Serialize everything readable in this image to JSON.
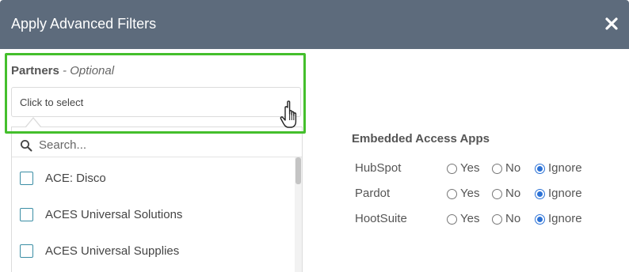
{
  "dialog": {
    "title": "Apply Advanced Filters",
    "close_icon": "close-icon"
  },
  "partners": {
    "label": "Partners",
    "optional_text": "- Optional",
    "select_placeholder": "Click to select",
    "search_placeholder": "Search...",
    "search_value": "",
    "items": [
      {
        "label": "ACE: Disco",
        "checked": false
      },
      {
        "label": "ACES Universal Solutions",
        "checked": false
      },
      {
        "label": "ACES Universal Supplies",
        "checked": false
      }
    ]
  },
  "embedded_apps": {
    "title": "Embedded Access Apps",
    "options": [
      "Yes",
      "No",
      "Ignore"
    ],
    "apps": [
      {
        "name": "HubSpot",
        "selected": "Ignore"
      },
      {
        "name": "Pardot",
        "selected": "Ignore"
      },
      {
        "name": "HootSuite",
        "selected": "Ignore"
      }
    ]
  },
  "colors": {
    "header_bg": "#5d6b7c",
    "highlight_border": "#44bf2c",
    "checkbox_border": "#3b8ea5",
    "radio_selected": "#2c72d6"
  }
}
